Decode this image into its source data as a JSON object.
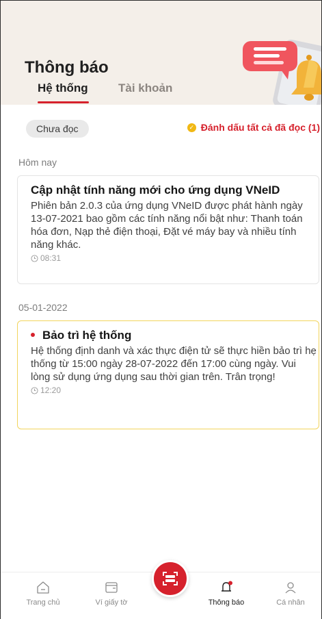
{
  "header": {
    "title": "Thông báo",
    "tabs": [
      {
        "label": "Hệ thống",
        "active": true
      },
      {
        "label": "Tài khoản",
        "active": false
      }
    ]
  },
  "filters": {
    "chip_label": "Chưa đọc",
    "mark_all_label": "Đánh dấu tất cả đã đọc (1)"
  },
  "sections": [
    {
      "label": "Hôm nay",
      "items": [
        {
          "title": "Cập nhật tính năng mới cho ứng dụng VNeID",
          "body": "Phiên bản 2.0.3 của ứng dụng VNeID được phát hành ngày 13-07-2021 bao gồm các tính năng nổi bật như: Thanh toán hóa đơn, Nạp thẻ điện thoại, Đặt vé máy bay và nhiều tính năng khác.",
          "time": "08:31",
          "unread": false
        }
      ]
    },
    {
      "label": "05-01-2022",
      "items": [
        {
          "title": "Bảo trì hệ thống",
          "body": "Hệ thống định danh và xác thực điện tử sẽ thực hiền bảo trì hẹ thống từ 15:00 ngày 28-07-2022 đến 17:00 cùng ngày. Vui lòng sử dụng ứng dụng sau thời gian trên. Trân trọng!",
          "time": "12:20",
          "unread": true
        }
      ]
    }
  ],
  "bottom_nav": [
    {
      "label": "Trang chủ",
      "icon": "home-icon"
    },
    {
      "label": "Ví giấy tờ",
      "icon": "wallet-icon"
    },
    {
      "label": "",
      "icon": "scan-icon"
    },
    {
      "label": "Thông báo",
      "icon": "bell-icon",
      "active": true
    },
    {
      "label": "Cá nhân",
      "icon": "user-icon"
    }
  ],
  "colors": {
    "accent": "#d6212c",
    "header_bg": "#f4efe9",
    "unread_border": "#f2d45c",
    "check_badge": "#f1b814"
  }
}
